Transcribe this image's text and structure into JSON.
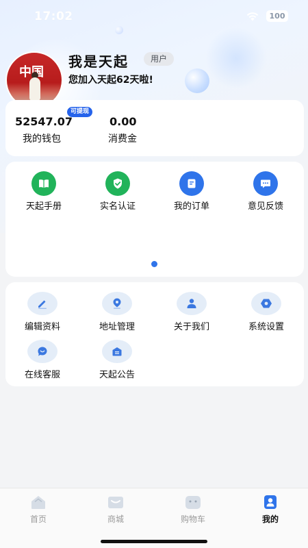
{
  "status_bar": {
    "time": "17:02",
    "battery": "100"
  },
  "profile": {
    "name": "我是天起",
    "role": "用户",
    "joined_text": "您加入天起62天啦!",
    "avatar_text": "中国"
  },
  "wallet": {
    "balance": "52547.07",
    "balance_label": "我的钱包",
    "withdraw_tag": "可提现",
    "spend": "0.00",
    "spend_label": "消费金"
  },
  "services": [
    {
      "label": "天起手册",
      "icon": "book-icon",
      "color": "#21b35a"
    },
    {
      "label": "实名认证",
      "icon": "shield-check-icon",
      "color": "#21b35a"
    },
    {
      "label": "我的订单",
      "icon": "order-doc-icon",
      "color": "#2f74ea"
    },
    {
      "label": "意见反馈",
      "icon": "chat-bubble-icon",
      "color": "#2f74ea"
    }
  ],
  "settings": [
    {
      "label": "编辑资料",
      "icon": "pencil-icon"
    },
    {
      "label": "地址管理",
      "icon": "location-pin-icon"
    },
    {
      "label": "关于我们",
      "icon": "person-icon"
    },
    {
      "label": "系统设置",
      "icon": "gear-icon"
    },
    {
      "label": "在线客服",
      "icon": "customer-service-icon"
    },
    {
      "label": "天起公告",
      "icon": "announcement-icon"
    }
  ],
  "tabbar": [
    {
      "label": "首页",
      "icon": "home-icon",
      "active": false
    },
    {
      "label": "商城",
      "icon": "mall-icon",
      "active": false
    },
    {
      "label": "购物车",
      "icon": "cart-icon",
      "active": false
    },
    {
      "label": "我的",
      "icon": "profile-icon",
      "active": true
    }
  ],
  "colors": {
    "accent": "#2f74ea",
    "green": "#21b35a",
    "background": "#f3f4f6"
  }
}
